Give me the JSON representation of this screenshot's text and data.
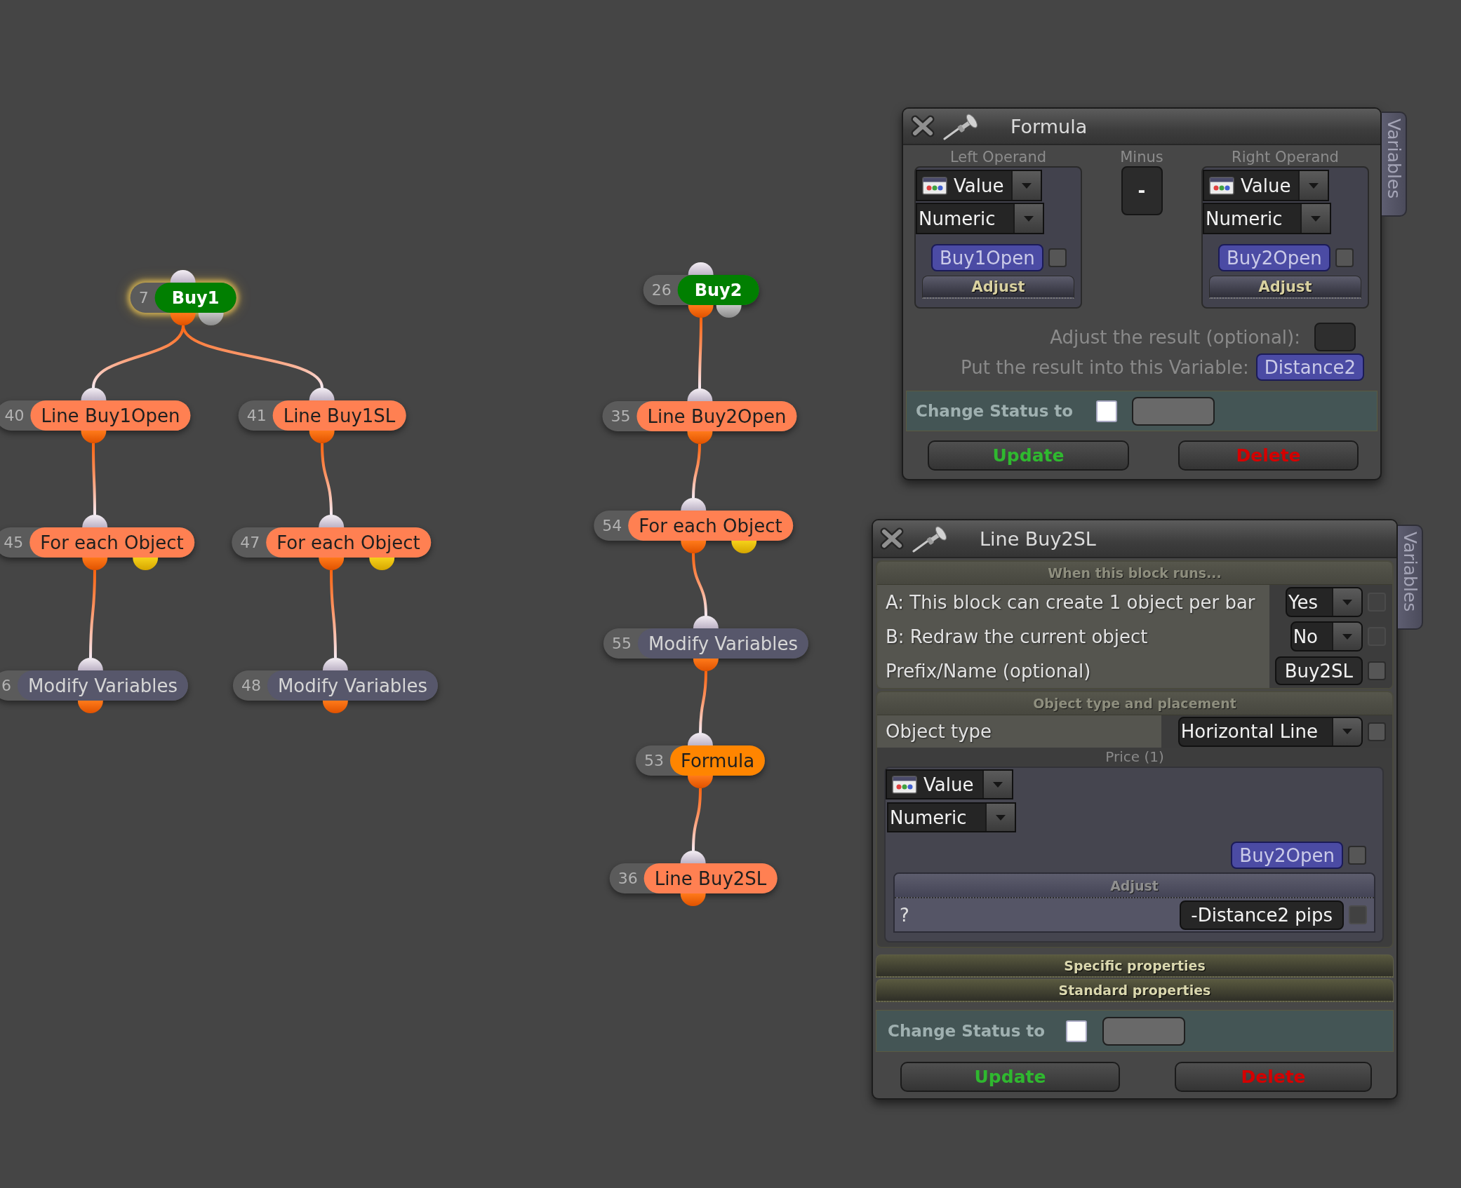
{
  "canvas": {
    "nodes": [
      {
        "number": "7",
        "label": "Buy1",
        "kind": "start",
        "selected": true,
        "children": [
          {
            "number": "40",
            "label": "Line Buy1Open",
            "kind": "object",
            "selected": false,
            "children": [
              {
                "number": "45",
                "label": "For each Object",
                "kind": "loop",
                "selected": false,
                "children": [
                  {
                    "number": "6",
                    "label": "Modify Variables",
                    "kind": "variables",
                    "selected": false
                  }
                ]
              }
            ]
          },
          {
            "number": "41",
            "label": "Line Buy1SL",
            "kind": "object",
            "selected": false,
            "children": [
              {
                "number": "47",
                "label": "For each Object",
                "kind": "loop",
                "selected": false,
                "children": [
                  {
                    "number": "48",
                    "label": "Modify Variables",
                    "kind": "variables",
                    "selected": false
                  }
                ]
              }
            ]
          }
        ]
      },
      {
        "number": "26",
        "label": "Buy2",
        "kind": "start",
        "selected": false,
        "children": [
          {
            "number": "35",
            "label": "Line Buy2Open",
            "kind": "object",
            "selected": false,
            "children": [
              {
                "number": "54",
                "label": "For each Object",
                "kind": "loop",
                "selected": false,
                "children": [
                  {
                    "number": "55",
                    "label": "Modify Variables",
                    "kind": "variables",
                    "selected": false,
                    "children": [
                      {
                        "number": "53",
                        "label": "Formula",
                        "kind": "formula",
                        "selected": false,
                        "children": [
                          {
                            "number": "36",
                            "label": "Line Buy2SL",
                            "kind": "object",
                            "selected": false
                          }
                        ]
                      }
                    ]
                  }
                ]
              }
            ]
          }
        ]
      }
    ]
  },
  "formula_window": {
    "title": "Formula",
    "side_tab": "Variables",
    "left_operand": {
      "heading": "Left Operand",
      "source": "Value",
      "type": "Numeric",
      "variable": "Buy1Open",
      "checked": false,
      "adjust": "Adjust"
    },
    "operator": {
      "heading": "Minus",
      "symbol": "-"
    },
    "right_operand": {
      "heading": "Right Operand",
      "source": "Value",
      "type": "Numeric",
      "variable": "Buy2Open",
      "checked": false,
      "adjust": "Adjust"
    },
    "adjust_result": {
      "label": "Adjust the result (optional):"
    },
    "result": {
      "label": "Put the result into this Variable:",
      "variable": "Distance2"
    },
    "change_status": {
      "label": "Change Status to",
      "checked": false
    },
    "buttons": [
      {
        "label": "Update",
        "kind": "update"
      },
      {
        "label": "Delete",
        "kind": "delete"
      }
    ]
  },
  "block_window": {
    "title": "Line Buy2SL",
    "side_tab": "Variables",
    "sections": [
      {
        "heading": "When this block runs...",
        "rows": [
          {
            "kind": "dropdown",
            "label": "A: This block can create 1 object per bar",
            "value": "Yes",
            "checkbox": {
              "checked": false,
              "disabled": true
            }
          },
          {
            "kind": "dropdown",
            "label": "B: Redraw the current object",
            "value": "No",
            "checkbox": {
              "checked": false,
              "disabled": true
            }
          },
          {
            "kind": "text",
            "label": "Prefix/Name (optional)",
            "value": "Buy2SL",
            "checkbox": {
              "checked": false,
              "disabled": false
            }
          }
        ]
      },
      {
        "heading": "Object type and placement",
        "rows": [
          {
            "kind": "dropdown",
            "label": "Object type",
            "value": "Horizontal Line",
            "checkbox": {
              "checked": false,
              "disabled": false
            }
          }
        ],
        "price": {
          "label": "Price (1)",
          "source": "Value",
          "type": "Numeric",
          "variable": "Buy2Open",
          "checked": false,
          "adjust": {
            "heading": "Adjust",
            "label": "?",
            "value": "-Distance2 pips",
            "checkbox": {
              "checked": false,
              "disabled": true
            }
          }
        }
      }
    ],
    "collapsed_sections": [
      "Specific properties",
      "Standard properties"
    ],
    "change_status": {
      "label": "Change Status to",
      "checked": false
    },
    "buttons": [
      {
        "label": "Update",
        "kind": "update"
      },
      {
        "label": "Delete",
        "kind": "delete"
      }
    ]
  }
}
